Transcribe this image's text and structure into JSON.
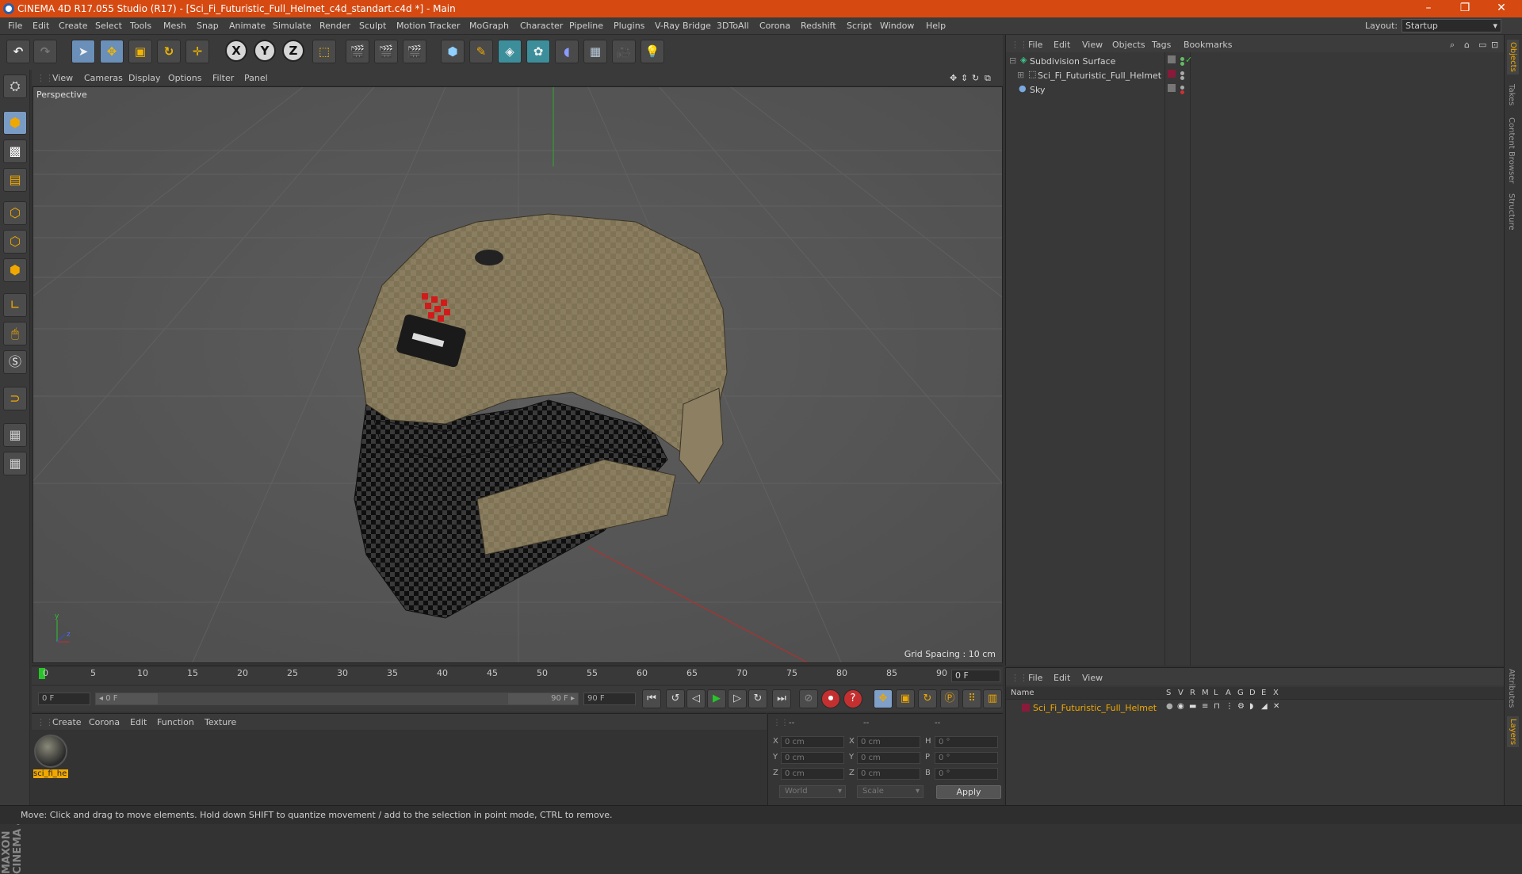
{
  "window": {
    "title": "CINEMA 4D R17.055 Studio (R17) - [Sci_Fi_Futuristic_Full_Helmet_c4d_standart.c4d *] - Main",
    "minimize": "–",
    "restore": "❐",
    "close": "✕"
  },
  "menubar": {
    "items": [
      "File",
      "Edit",
      "Create",
      "Select",
      "Tools",
      "Mesh",
      "Snap",
      "Animate",
      "Simulate",
      "Render",
      "Sculpt",
      "Motion Tracker",
      "MoGraph",
      "Character",
      "Pipeline",
      "Plugins",
      "V-Ray Bridge",
      "3DToAll",
      "Corona",
      "Redshift",
      "Script",
      "Window",
      "Help"
    ],
    "layout_label": "Layout:",
    "layout_value": "Startup"
  },
  "toolbar": {
    "axis_x": "X",
    "axis_y": "Y",
    "axis_z": "Z"
  },
  "viewport": {
    "menu": [
      "View",
      "Cameras",
      "Display",
      "Options",
      "Filter",
      "Panel"
    ],
    "label": "Perspective",
    "grid_spacing": "Grid Spacing : 10 cm"
  },
  "timeline": {
    "ticks": [
      "0",
      "5",
      "10",
      "15",
      "20",
      "25",
      "30",
      "35",
      "40",
      "45",
      "50",
      "55",
      "60",
      "65",
      "70",
      "75",
      "80",
      "85",
      "90"
    ],
    "current_frame": "0 F"
  },
  "transport": {
    "start_field": "0 F",
    "range_start": "◂ 0 F",
    "range_end": "90 F ▸",
    "end_field": "90 F"
  },
  "material_manager": {
    "menu": [
      "Create",
      "Corona",
      "Edit",
      "Function",
      "Texture"
    ],
    "material_name": "sci_fi_he"
  },
  "coordinates": {
    "headers": [
      "--",
      "--",
      "--"
    ],
    "rows": [
      {
        "l1": "X",
        "v1": "0 cm",
        "l2": "X",
        "v2": "0 cm",
        "l3": "H",
        "v3": "0 °"
      },
      {
        "l1": "Y",
        "v1": "0 cm",
        "l2": "Y",
        "v2": "0 cm",
        "l3": "P",
        "v3": "0 °"
      },
      {
        "l1": "Z",
        "v1": "0 cm",
        "l2": "Z",
        "v2": "0 cm",
        "l3": "B",
        "v3": "0 °"
      }
    ],
    "space": "World",
    "mode": "Scale",
    "apply": "Apply"
  },
  "object_manager": {
    "menu": [
      "File",
      "Edit",
      "View",
      "Objects",
      "Tags",
      "Bookmarks"
    ],
    "objects": [
      "Subdivision Surface",
      "Sci_Fi_Futuristic_Full_Helmet",
      "Sky"
    ]
  },
  "layer_manager": {
    "menu": [
      "File",
      "Edit",
      "View"
    ],
    "columns": [
      "Name",
      "S",
      "V",
      "R",
      "M",
      "L",
      "A",
      "G",
      "D",
      "E",
      "X"
    ],
    "layer_name": "Sci_Fi_Futuristic_Full_Helmet"
  },
  "right_tabs": [
    "Objects",
    "Takes",
    "Content Browser",
    "Structure",
    "Attributes",
    "Layers"
  ],
  "status": "Move: Click and drag to move elements. Hold down SHIFT to quantize movement / add to the selection in point mode, CTRL to remove.",
  "logo": "MAXON CINEMA 4D",
  "colors": {
    "title_bar": "#d64a12",
    "accent": "#f0a800",
    "viewport_bg": "#575757",
    "helmet_shell": "#8a7d60",
    "helmet_lower": "#1e1e1e"
  }
}
